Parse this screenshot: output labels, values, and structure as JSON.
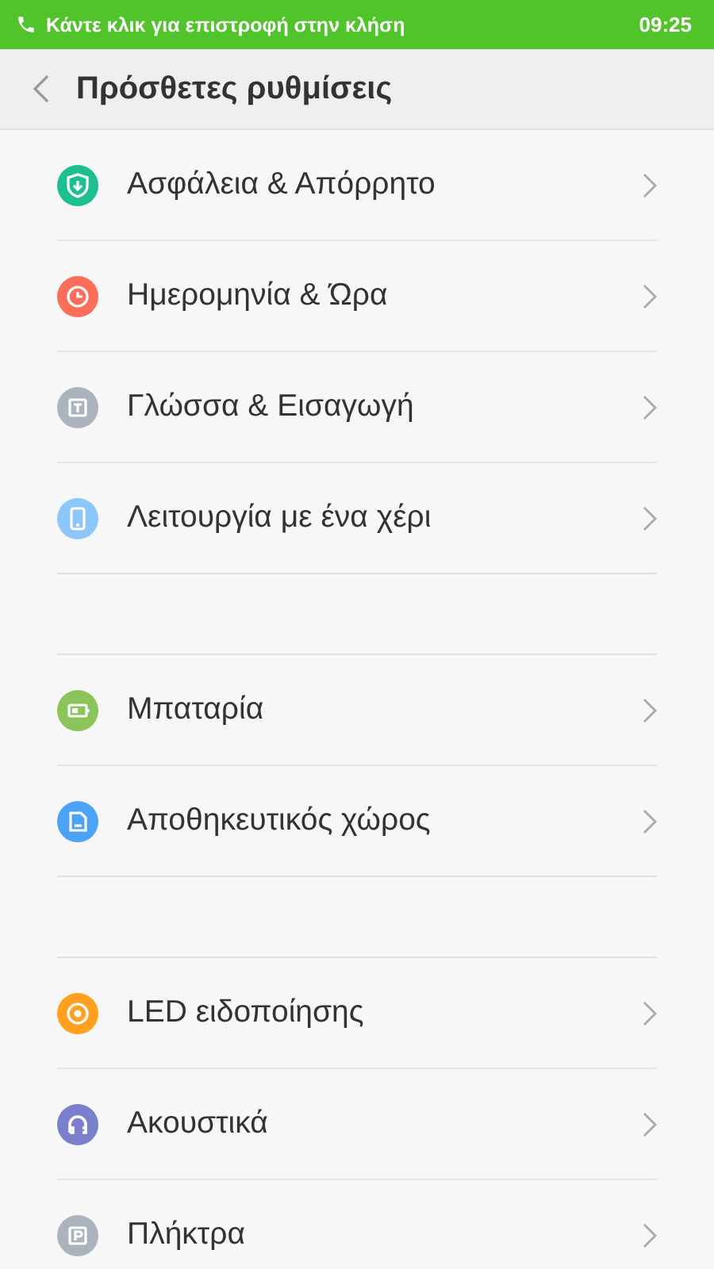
{
  "status_bar": {
    "message": "Κάντε κλικ για επιστροφή στην κλήση",
    "time": "09:25"
  },
  "header": {
    "title": "Πρόσθετες ρυθμίσεις"
  },
  "groups": [
    {
      "items": [
        {
          "label": "Ασφάλεια & Απόρρητο",
          "kind": "shield",
          "color": "#1dbf8e"
        },
        {
          "label": "Ημερομηνία & Ώρα",
          "kind": "clock",
          "color": "#fa6e5a"
        },
        {
          "label": "Γλώσσα & Εισαγωγή",
          "kind": "text",
          "color": "#abb4be"
        },
        {
          "label": "Λειτουργία με ένα χέρι",
          "kind": "phone",
          "color": "#8dc6fb"
        }
      ]
    },
    {
      "items": [
        {
          "label": "Μπαταρία",
          "kind": "battery",
          "color": "#8bc55a"
        },
        {
          "label": "Αποθηκευτικός χώρος",
          "kind": "storage",
          "color": "#4aa3f5"
        }
      ]
    },
    {
      "items": [
        {
          "label": "LED ειδοποίησης",
          "kind": "led",
          "color": "#ffa020"
        },
        {
          "label": "Ακουστικά",
          "kind": "headphones",
          "color": "#7b80cc"
        },
        {
          "label": "Πλήκτρα",
          "kind": "keys",
          "color": "#abb4be"
        }
      ]
    }
  ]
}
